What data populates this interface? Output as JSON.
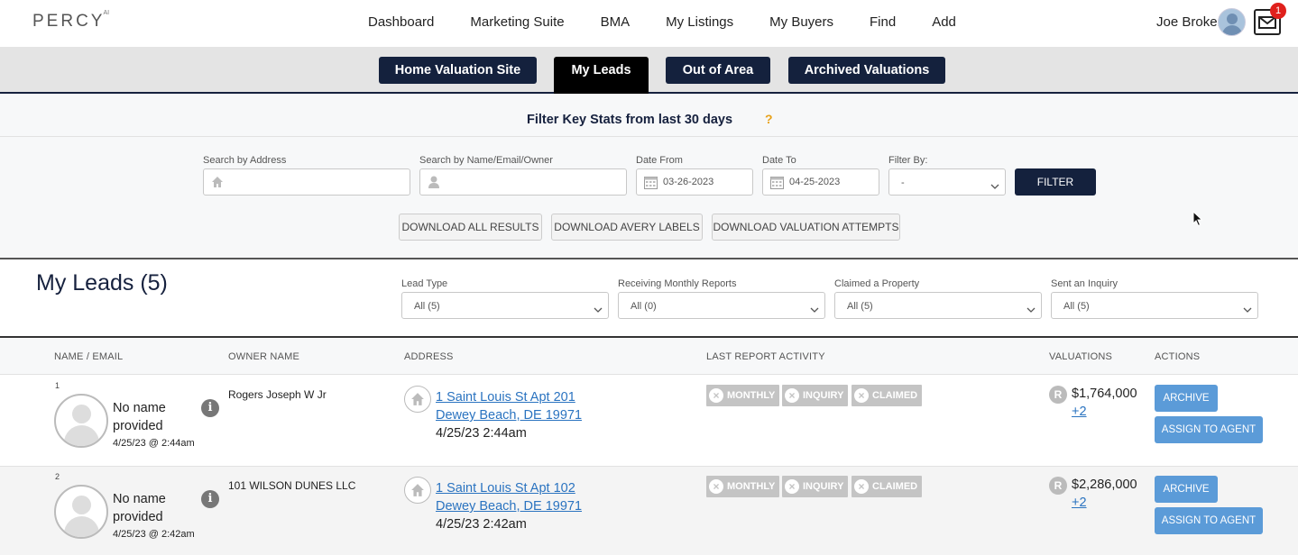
{
  "brand": {
    "logo": "PERCY",
    "logo_sup": "AI"
  },
  "nav": {
    "items": [
      "Dashboard",
      "Marketing Suite",
      "BMA",
      "My Listings",
      "My Buyers",
      "Find",
      "Add"
    ],
    "user_name": "Joe Broker",
    "mail_count": "1"
  },
  "tabs": [
    {
      "label": "Home Valuation Site",
      "active": false
    },
    {
      "label": "My Leads",
      "active": true
    },
    {
      "label": "Out of Area",
      "active": false
    },
    {
      "label": "Archived Valuations",
      "active": false
    }
  ],
  "stats": {
    "title": "Filter Key Stats from last 30 days",
    "help": "?"
  },
  "search": {
    "address_label": "Search by Address",
    "name_label": "Search by Name/Email/Owner",
    "date_from_label": "Date From",
    "date_from_value": "03-26-2023",
    "date_to_label": "Date To",
    "date_to_value": "04-25-2023",
    "filter_by_label": "Filter By:",
    "filter_by_value": "-",
    "filter_button": "FILTER",
    "download_all": "DOWNLOAD ALL RESULTS",
    "download_avery": "DOWNLOAD AVERY LABELS",
    "download_attempts": "DOWNLOAD VALUATION ATTEMPTS"
  },
  "leads": {
    "title": "My Leads (5)",
    "filters": [
      {
        "label": "Lead Type",
        "value": "All (5)"
      },
      {
        "label": "Receiving Monthly Reports",
        "value": "All (0)"
      },
      {
        "label": "Claimed a Property",
        "value": "All (5)"
      },
      {
        "label": "Sent an Inquiry",
        "value": "All (5)"
      }
    ]
  },
  "table": {
    "headers": [
      "NAME / EMAIL",
      "OWNER NAME",
      "ADDRESS",
      "LAST REPORT ACTIVITY",
      "VALUATIONS",
      "ACTIONS"
    ],
    "rows": [
      {
        "num": "1",
        "name": "No name provided",
        "time": "4/25/23 @ 2:44am",
        "owner": "Rogers Joseph W Jr",
        "addr1": "1 Saint Louis St Apt 201",
        "addr2": "Dewey Beach, DE 19971",
        "addr_time": "4/25/23 2:44am",
        "activity": [
          "MONTHLY",
          "INQUIRY",
          "CLAIMED"
        ],
        "r": "R",
        "value": "$1,764,000",
        "more": "+2",
        "archive": "ARCHIVE",
        "assign": "ASSIGN TO AGENT"
      },
      {
        "num": "2",
        "name": "No name provided",
        "time": "4/25/23 @ 2:42am",
        "owner": "101 WILSON DUNES LLC",
        "addr1": "1 Saint Louis St Apt 102",
        "addr2": "Dewey Beach, DE 19971",
        "addr_time": "4/25/23 2:42am",
        "activity": [
          "MONTHLY",
          "INQUIRY",
          "CLAIMED"
        ],
        "r": "R",
        "value": "$2,286,000",
        "more": "+2",
        "archive": "ARCHIVE",
        "assign": "ASSIGN TO AGENT"
      }
    ]
  },
  "icons": [
    "house-icon",
    "person-icon",
    "calendar-icon",
    "chevron-down-icon",
    "mail-icon",
    "info-icon",
    "close-icon"
  ],
  "colors": {
    "navy": "#14213d",
    "action_blue": "#5b9bd8",
    "link": "#2a73c0",
    "help": "#e8a21a",
    "badge": "#e0201c"
  }
}
